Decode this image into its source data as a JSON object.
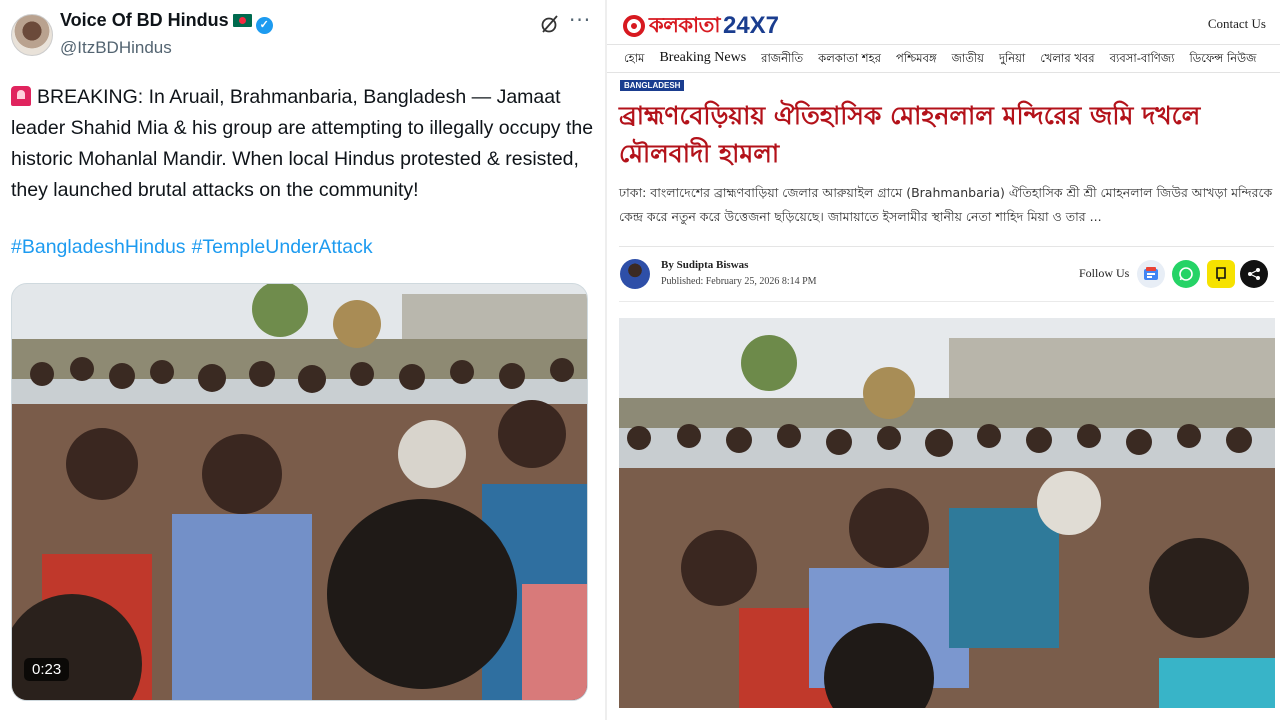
{
  "tweet": {
    "display_name": "Voice Of BD Hindus",
    "handle": "@ItzBDHindus",
    "text": "BREAKING: In Aruail, Brahmanbaria, Bangladesh — Jamaat leader Shahid Mia & his group are attempting to illegally occupy the historic Mohanlal Mandir. When local Hindus protested & resisted, they launched brutal attacks on the community!",
    "hashtags": [
      "#BangladeshHindus",
      "#TempleUnderAttack"
    ],
    "video_duration": "0:23",
    "icons": [
      "siren-icon",
      "bangladesh-flag-icon",
      "verified-badge-icon",
      "grok-icon",
      "more-options-icon"
    ]
  },
  "news": {
    "logo_bengali": "কলকাতা",
    "logo_number": "24X7",
    "contact": "Contact Us",
    "nav": [
      "হোম",
      "Breaking News",
      "রাজনীতি",
      "কলকাতা শহর",
      "পশ্চিমবঙ্গ",
      "জাতীয়",
      "দুনিয়া",
      "খেলার খবর",
      "ব্যবসা-বাণিজ্য",
      "ডিফেন্স নিউজ"
    ],
    "category": "BANGLADESH",
    "headline": "ব্রাহ্মণবেড়িয়ায় ঐতিহাসিক মোহনলাল মন্দিরের জমি দখলে মৌলবাদী হামলা",
    "excerpt": "ঢাকা: বাংলাদেশের ব্রাহ্মণবাড়িয়া জেলার আরুয়াইল গ্রামে (Brahmanbaria) ঐতিহাসিক শ্রী শ্রী মোহনলাল জিউর আখড়া মন্দিরকে কেন্দ্র করে নতুন করে উত্তেজনা ছড়িয়েছে। জামায়াতে ইসলামীর স্থানীয় নেতা শাহিদ মিয়া ও তার ...",
    "author": "By Sudipta Biswas",
    "published": "Published: February 25, 2026 8:14 PM",
    "follow_label": "Follow Us",
    "share_icons": [
      "google-news-icon",
      "whatsapp-icon",
      "koo-icon",
      "share-icon"
    ]
  }
}
